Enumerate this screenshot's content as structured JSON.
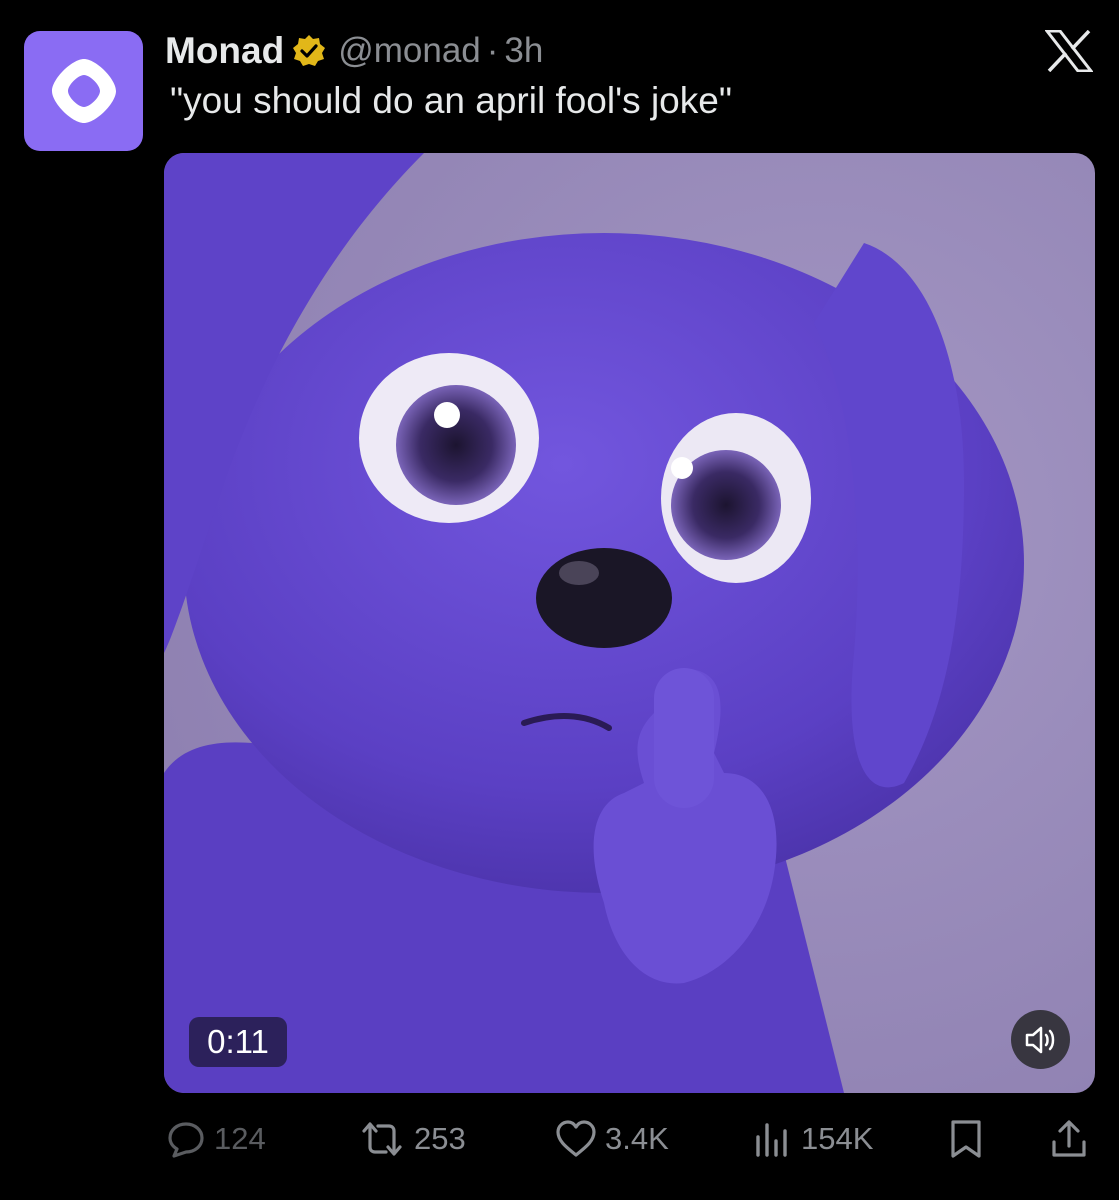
{
  "author": {
    "name": "Monad",
    "handle": "@monad",
    "separator": "·",
    "time": "3h",
    "verified_icon": "gold-verified-badge-icon",
    "avatar_icon": "monad-logo-icon",
    "avatar_color": "#8a6cf3"
  },
  "platform_icon": "x-logo-icon",
  "tweet": {
    "text": "\"you should do an april fool's joke\""
  },
  "media": {
    "type": "video",
    "duration": "0:11",
    "sound_icon": "speaker-icon",
    "dominant_color": "#6a4ed0"
  },
  "actions": {
    "replies": {
      "icon": "reply-icon",
      "count": "124"
    },
    "reposts": {
      "icon": "repost-icon",
      "count": "253"
    },
    "likes": {
      "icon": "heart-icon",
      "count": "3.4K"
    },
    "views": {
      "icon": "analytics-icon",
      "count": "154K"
    },
    "bookmark": {
      "icon": "bookmark-icon"
    },
    "share": {
      "icon": "share-icon"
    }
  },
  "colors": {
    "background": "#000000",
    "text_primary": "#e7e9ea",
    "text_secondary": "#8b8e93",
    "verified_gold": "#e2b719"
  }
}
